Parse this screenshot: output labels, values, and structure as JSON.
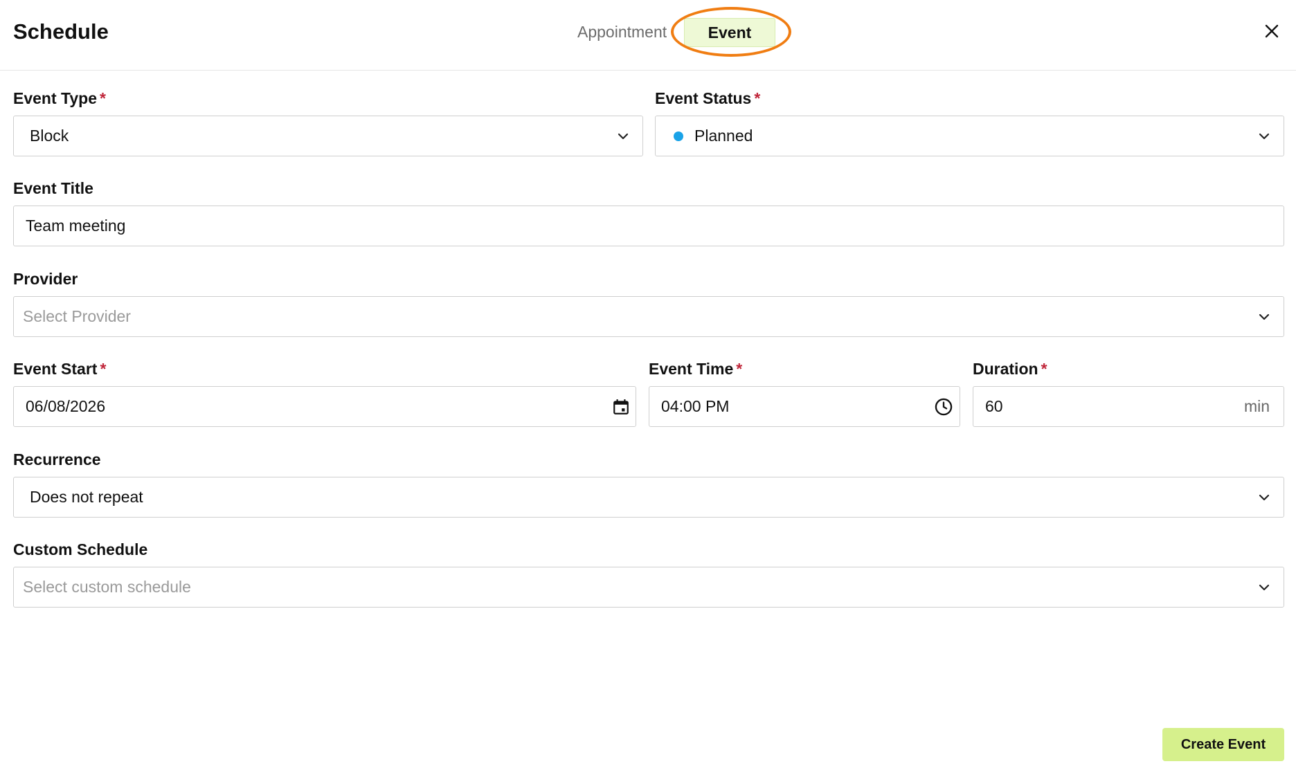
{
  "header": {
    "title": "Schedule",
    "tabs": [
      {
        "label": "Appointment",
        "active": false
      },
      {
        "label": "Event",
        "active": true
      }
    ],
    "close_icon": "close-icon",
    "highlight_color": "#f07d12"
  },
  "form": {
    "event_type": {
      "label": "Event Type",
      "required": "*",
      "value": "Block"
    },
    "event_status": {
      "label": "Event Status",
      "required": "*",
      "value": "Planned",
      "status_color": "#1aa3e8"
    },
    "event_title": {
      "label": "Event Title",
      "value": "Team meeting"
    },
    "provider": {
      "label": "Provider",
      "placeholder": "Select Provider"
    },
    "event_start": {
      "label": "Event Start",
      "required": "*",
      "value": "06/08/2026",
      "icon": "calendar-icon"
    },
    "event_time": {
      "label": "Event Time",
      "required": "*",
      "value": "04:00 PM",
      "icon": "clock-icon"
    },
    "duration": {
      "label": "Duration",
      "required": "*",
      "value": "60",
      "unit": "min"
    },
    "recurrence": {
      "label": "Recurrence",
      "value": "Does not repeat"
    },
    "custom_schedule": {
      "label": "Custom Schedule",
      "placeholder": "Select custom schedule"
    }
  },
  "footer": {
    "create_label": "Create Event",
    "button_color": "#d6f08c"
  }
}
